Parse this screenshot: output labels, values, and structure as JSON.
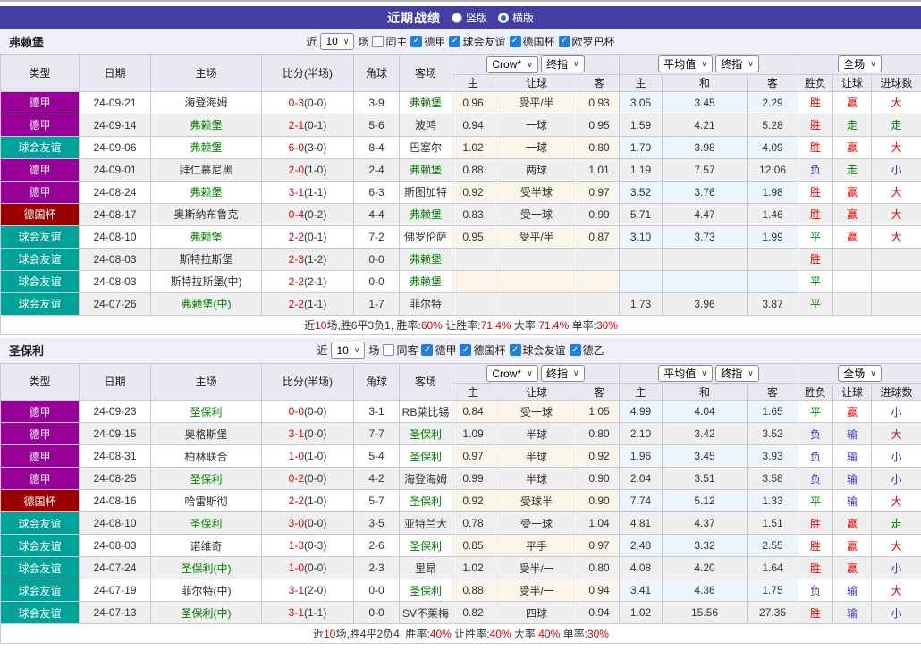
{
  "title_bar": {
    "title": "近期战绩",
    "layout_options": [
      {
        "label": "竖版",
        "selected": false
      },
      {
        "label": "横版",
        "selected": true
      }
    ]
  },
  "table_header": {
    "static_columns": [
      "类型",
      "日期",
      "主场",
      "比分(半场)",
      "角球",
      "客场"
    ],
    "group1": {
      "select1": "Crow*",
      "select2": "终指",
      "columns": [
        "主",
        "让球",
        "客"
      ]
    },
    "group2": {
      "select1": "平均值",
      "select2": "终指",
      "columns": [
        "主",
        "和",
        "客"
      ]
    },
    "group3": {
      "select1": "全场",
      "columns": [
        "胜负",
        "让球",
        "进球数"
      ]
    }
  },
  "league_colors": {
    "德甲": "#990099",
    "球会友谊": "#00A39A",
    "德国杯": "#9B0000",
    "德乙": "#009900"
  },
  "result_colors": {
    "胜": "#E80000",
    "平": "#008000",
    "负": "#3333CC",
    "赢": "#E80000",
    "走": "#008000",
    "输": "#3333CC",
    "大": "#E80000",
    "小": "#3333CC"
  },
  "sections": [
    {
      "team": "弗赖堡",
      "filter": {
        "prefix": "近",
        "count": "10",
        "suffix": "场",
        "same_label": "同主",
        "same_checked": false,
        "leagues": [
          {
            "label": "德甲",
            "checked": true
          },
          {
            "label": "球会友谊",
            "checked": true
          },
          {
            "label": "德国杯",
            "checked": true
          },
          {
            "label": "欧罗巴杯",
            "checked": true
          }
        ]
      },
      "rows": [
        {
          "league": "德甲",
          "date": "24-09-21",
          "home": "海登海姆",
          "homeSelf": false,
          "score": "0-3",
          "half": "(0-0)",
          "corners": "3-9",
          "away": "弗赖堡",
          "awaySelf": true,
          "letHome": "0.96",
          "handicap": "受平/半",
          "letAway": "0.93",
          "avgHome": "3.05",
          "avgDraw": "3.45",
          "avgAway": "2.29",
          "resWdl": "胜",
          "resLet": "赢",
          "resGoal": "大"
        },
        {
          "league": "德甲",
          "date": "24-09-14",
          "home": "弗赖堡",
          "homeSelf": true,
          "score": "2-1",
          "half": "(0-1)",
          "corners": "5-6",
          "away": "波鸿",
          "awaySelf": false,
          "letHome": "0.94",
          "handicap": "一球",
          "letAway": "0.95",
          "avgHome": "1.59",
          "avgDraw": "4.21",
          "avgAway": "5.28",
          "resWdl": "胜",
          "resLet": "走",
          "resGoal": "走"
        },
        {
          "league": "球会友谊",
          "date": "24-09-06",
          "home": "弗赖堡",
          "homeSelf": true,
          "score": "6-0",
          "half": "(3-0)",
          "corners": "8-4",
          "away": "巴塞尔",
          "awaySelf": false,
          "letHome": "1.02",
          "handicap": "一球",
          "letAway": "0.80",
          "avgHome": "1.70",
          "avgDraw": "3.98",
          "avgAway": "4.09",
          "resWdl": "胜",
          "resLet": "赢",
          "resGoal": "大"
        },
        {
          "league": "德甲",
          "date": "24-09-01",
          "home": "拜仁慕尼黑",
          "homeSelf": false,
          "score": "2-0",
          "half": "(1-0)",
          "corners": "2-4",
          "away": "弗赖堡",
          "awaySelf": true,
          "letHome": "0.88",
          "handicap": "两球",
          "letAway": "1.01",
          "avgHome": "1.19",
          "avgDraw": "7.57",
          "avgAway": "12.06",
          "resWdl": "负",
          "resLet": "走",
          "resGoal": "小"
        },
        {
          "league": "德甲",
          "date": "24-08-24",
          "home": "弗赖堡",
          "homeSelf": true,
          "score": "3-1",
          "half": "(1-1)",
          "corners": "6-3",
          "away": "斯图加特",
          "awaySelf": false,
          "letHome": "0.92",
          "handicap": "受半球",
          "letAway": "0.97",
          "avgHome": "3.52",
          "avgDraw": "3.76",
          "avgAway": "1.98",
          "resWdl": "胜",
          "resLet": "赢",
          "resGoal": "大"
        },
        {
          "league": "德国杯",
          "date": "24-08-17",
          "home": "奥斯纳布鲁克",
          "homeSelf": false,
          "score": "0-4",
          "half": "(0-2)",
          "corners": "4-4",
          "away": "弗赖堡",
          "awaySelf": true,
          "letHome": "0.83",
          "handicap": "受一球",
          "letAway": "0.99",
          "avgHome": "5.71",
          "avgDraw": "4.47",
          "avgAway": "1.46",
          "resWdl": "胜",
          "resLet": "赢",
          "resGoal": "大"
        },
        {
          "league": "球会友谊",
          "date": "24-08-10",
          "home": "弗赖堡",
          "homeSelf": true,
          "score": "2-2",
          "half": "(0-1)",
          "corners": "7-2",
          "away": "佛罗伦萨",
          "awaySelf": false,
          "letHome": "0.95",
          "handicap": "受平/半",
          "letAway": "0.87",
          "avgHome": "3.10",
          "avgDraw": "3.73",
          "avgAway": "1.99",
          "resWdl": "平",
          "resLet": "赢",
          "resGoal": "大"
        },
        {
          "league": "球会友谊",
          "date": "24-08-03",
          "home": "斯特拉斯堡",
          "homeSelf": false,
          "score": "2-3",
          "half": "(1-2)",
          "corners": "0-0",
          "away": "弗赖堡",
          "awaySelf": true,
          "letHome": "",
          "handicap": "",
          "letAway": "",
          "avgHome": "",
          "avgDraw": "",
          "avgAway": "",
          "resWdl": "胜",
          "resLet": "",
          "resGoal": ""
        },
        {
          "league": "球会友谊",
          "date": "24-08-03",
          "home": "斯特拉斯堡(中)",
          "homeSelf": false,
          "score": "2-2",
          "half": "(2-1)",
          "corners": "0-0",
          "away": "弗赖堡",
          "awaySelf": true,
          "letHome": "",
          "handicap": "",
          "letAway": "",
          "avgHome": "",
          "avgDraw": "",
          "avgAway": "",
          "resWdl": "平",
          "resLet": "",
          "resGoal": ""
        },
        {
          "league": "球会友谊",
          "date": "24-07-26",
          "home": "弗赖堡(中)",
          "homeSelf": true,
          "score": "2-2",
          "half": "(1-1)",
          "corners": "1-7",
          "away": "菲尔特",
          "awaySelf": false,
          "letHome": "",
          "handicap": "",
          "letAway": "",
          "avgHome": "1.73",
          "avgDraw": "3.96",
          "avgAway": "3.87",
          "resWdl": "平",
          "resLet": "",
          "resGoal": ""
        }
      ],
      "summary_parts": [
        "近",
        "10",
        "场,胜6平3负1, 胜率:",
        "60%",
        " 让胜率:",
        "71.4%",
        " 大率:",
        "71.4%",
        " 单率:",
        "30%"
      ]
    },
    {
      "team": "圣保利",
      "filter": {
        "prefix": "近",
        "count": "10",
        "suffix": "场",
        "same_label": "同客",
        "same_checked": false,
        "leagues": [
          {
            "label": "德甲",
            "checked": true
          },
          {
            "label": "德国杯",
            "checked": true
          },
          {
            "label": "球会友谊",
            "checked": true
          },
          {
            "label": "德乙",
            "checked": true
          }
        ]
      },
      "rows": [
        {
          "league": "德甲",
          "date": "24-09-23",
          "home": "圣保利",
          "homeSelf": true,
          "score": "0-0",
          "half": "(0-0)",
          "corners": "3-1",
          "away": "RB莱比锡",
          "awaySelf": false,
          "letHome": "0.84",
          "handicap": "受一球",
          "letAway": "1.05",
          "avgHome": "4.99",
          "avgDraw": "4.04",
          "avgAway": "1.65",
          "resWdl": "平",
          "resLet": "赢",
          "resGoal": "小"
        },
        {
          "league": "德甲",
          "date": "24-09-15",
          "home": "奥格斯堡",
          "homeSelf": false,
          "score": "3-1",
          "half": "(0-0)",
          "corners": "7-7",
          "away": "圣保利",
          "awaySelf": true,
          "letHome": "1.09",
          "handicap": "半球",
          "letAway": "0.80",
          "avgHome": "2.10",
          "avgDraw": "3.42",
          "avgAway": "3.52",
          "resWdl": "负",
          "resLet": "输",
          "resGoal": "大"
        },
        {
          "league": "德甲",
          "date": "24-08-31",
          "home": "柏林联合",
          "homeSelf": false,
          "score": "1-0",
          "half": "(1-0)",
          "corners": "5-4",
          "away": "圣保利",
          "awaySelf": true,
          "letHome": "0.97",
          "handicap": "半球",
          "letAway": "0.92",
          "avgHome": "1.96",
          "avgDraw": "3.45",
          "avgAway": "3.93",
          "resWdl": "负",
          "resLet": "输",
          "resGoal": "小"
        },
        {
          "league": "德甲",
          "date": "24-08-25",
          "home": "圣保利",
          "homeSelf": true,
          "score": "0-2",
          "half": "(0-0)",
          "corners": "4-2",
          "away": "海登海姆",
          "awaySelf": false,
          "letHome": "0.99",
          "handicap": "半球",
          "letAway": "0.90",
          "avgHome": "2.04",
          "avgDraw": "3.51",
          "avgAway": "3.58",
          "resWdl": "负",
          "resLet": "输",
          "resGoal": "小"
        },
        {
          "league": "德国杯",
          "date": "24-08-16",
          "home": "哈雷斯彻",
          "homeSelf": false,
          "score": "2-2",
          "half": "(1-0)",
          "corners": "5-7",
          "away": "圣保利",
          "awaySelf": true,
          "letHome": "0.92",
          "handicap": "受球半",
          "letAway": "0.90",
          "avgHome": "7.74",
          "avgDraw": "5.12",
          "avgAway": "1.33",
          "resWdl": "平",
          "resLet": "输",
          "resGoal": "大"
        },
        {
          "league": "球会友谊",
          "date": "24-08-10",
          "home": "圣保利",
          "homeSelf": true,
          "score": "3-0",
          "half": "(0-0)",
          "corners": "3-5",
          "away": "亚特兰大",
          "awaySelf": false,
          "letHome": "0.78",
          "handicap": "受一球",
          "letAway": "1.04",
          "avgHome": "4.81",
          "avgDraw": "4.37",
          "avgAway": "1.51",
          "resWdl": "胜",
          "resLet": "赢",
          "resGoal": "走"
        },
        {
          "league": "球会友谊",
          "date": "24-08-03",
          "home": "诺维奇",
          "homeSelf": false,
          "score": "1-3",
          "half": "(0-3)",
          "corners": "2-6",
          "away": "圣保利",
          "awaySelf": true,
          "letHome": "0.85",
          "handicap": "平手",
          "letAway": "0.97",
          "avgHome": "2.48",
          "avgDraw": "3.32",
          "avgAway": "2.55",
          "resWdl": "胜",
          "resLet": "赢",
          "resGoal": "大"
        },
        {
          "league": "球会友谊",
          "date": "24-07-24",
          "home": "圣保利(中)",
          "homeSelf": true,
          "score": "1-0",
          "half": "(0-0)",
          "corners": "2-3",
          "away": "里昂",
          "awaySelf": false,
          "letHome": "1.02",
          "handicap": "受半/一",
          "letAway": "0.80",
          "avgHome": "4.08",
          "avgDraw": "4.20",
          "avgAway": "1.64",
          "resWdl": "胜",
          "resLet": "赢",
          "resGoal": "小"
        },
        {
          "league": "球会友谊",
          "date": "24-07-19",
          "home": "菲尔特(中)",
          "homeSelf": false,
          "score": "3-1",
          "half": "(2-0)",
          "corners": "0-0",
          "away": "圣保利",
          "awaySelf": true,
          "letHome": "0.88",
          "handicap": "受半/一",
          "letAway": "0.94",
          "avgHome": "3.41",
          "avgDraw": "4.36",
          "avgAway": "1.75",
          "resWdl": "负",
          "resLet": "输",
          "resGoal": "大"
        },
        {
          "league": "球会友谊",
          "date": "24-07-13",
          "home": "圣保利(中)",
          "homeSelf": true,
          "score": "3-1",
          "half": "(1-1)",
          "corners": "0-0",
          "away": "SV不莱梅",
          "awaySelf": false,
          "letHome": "0.82",
          "handicap": "四球",
          "letAway": "0.94",
          "avgHome": "1.02",
          "avgDraw": "15.56",
          "avgAway": "27.35",
          "resWdl": "胜",
          "resLet": "输",
          "resGoal": "小"
        }
      ],
      "summary_parts": [
        "近",
        "10",
        "场,胜4平2负4, 胜率:",
        "40%",
        " 让胜率:",
        "40%",
        " 大率:",
        "40%",
        " 单率:",
        "30%"
      ]
    }
  ]
}
